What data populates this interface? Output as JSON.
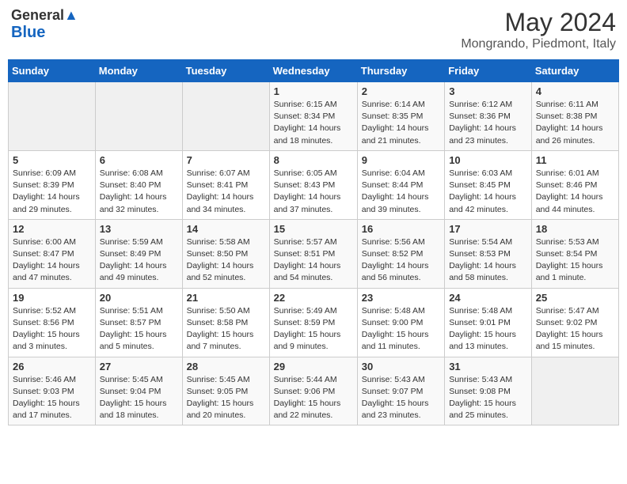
{
  "header": {
    "logo_general": "General",
    "logo_blue": "Blue",
    "month_title": "May 2024",
    "location": "Mongrando, Piedmont, Italy"
  },
  "days_of_week": [
    "Sunday",
    "Monday",
    "Tuesday",
    "Wednesday",
    "Thursday",
    "Friday",
    "Saturday"
  ],
  "weeks": [
    [
      {
        "day": "",
        "info": ""
      },
      {
        "day": "",
        "info": ""
      },
      {
        "day": "",
        "info": ""
      },
      {
        "day": "1",
        "info": "Sunrise: 6:15 AM\nSunset: 8:34 PM\nDaylight: 14 hours and 18 minutes."
      },
      {
        "day": "2",
        "info": "Sunrise: 6:14 AM\nSunset: 8:35 PM\nDaylight: 14 hours and 21 minutes."
      },
      {
        "day": "3",
        "info": "Sunrise: 6:12 AM\nSunset: 8:36 PM\nDaylight: 14 hours and 23 minutes."
      },
      {
        "day": "4",
        "info": "Sunrise: 6:11 AM\nSunset: 8:38 PM\nDaylight: 14 hours and 26 minutes."
      }
    ],
    [
      {
        "day": "5",
        "info": "Sunrise: 6:09 AM\nSunset: 8:39 PM\nDaylight: 14 hours and 29 minutes."
      },
      {
        "day": "6",
        "info": "Sunrise: 6:08 AM\nSunset: 8:40 PM\nDaylight: 14 hours and 32 minutes."
      },
      {
        "day": "7",
        "info": "Sunrise: 6:07 AM\nSunset: 8:41 PM\nDaylight: 14 hours and 34 minutes."
      },
      {
        "day": "8",
        "info": "Sunrise: 6:05 AM\nSunset: 8:43 PM\nDaylight: 14 hours and 37 minutes."
      },
      {
        "day": "9",
        "info": "Sunrise: 6:04 AM\nSunset: 8:44 PM\nDaylight: 14 hours and 39 minutes."
      },
      {
        "day": "10",
        "info": "Sunrise: 6:03 AM\nSunset: 8:45 PM\nDaylight: 14 hours and 42 minutes."
      },
      {
        "day": "11",
        "info": "Sunrise: 6:01 AM\nSunset: 8:46 PM\nDaylight: 14 hours and 44 minutes."
      }
    ],
    [
      {
        "day": "12",
        "info": "Sunrise: 6:00 AM\nSunset: 8:47 PM\nDaylight: 14 hours and 47 minutes."
      },
      {
        "day": "13",
        "info": "Sunrise: 5:59 AM\nSunset: 8:49 PM\nDaylight: 14 hours and 49 minutes."
      },
      {
        "day": "14",
        "info": "Sunrise: 5:58 AM\nSunset: 8:50 PM\nDaylight: 14 hours and 52 minutes."
      },
      {
        "day": "15",
        "info": "Sunrise: 5:57 AM\nSunset: 8:51 PM\nDaylight: 14 hours and 54 minutes."
      },
      {
        "day": "16",
        "info": "Sunrise: 5:56 AM\nSunset: 8:52 PM\nDaylight: 14 hours and 56 minutes."
      },
      {
        "day": "17",
        "info": "Sunrise: 5:54 AM\nSunset: 8:53 PM\nDaylight: 14 hours and 58 minutes."
      },
      {
        "day": "18",
        "info": "Sunrise: 5:53 AM\nSunset: 8:54 PM\nDaylight: 15 hours and 1 minute."
      }
    ],
    [
      {
        "day": "19",
        "info": "Sunrise: 5:52 AM\nSunset: 8:56 PM\nDaylight: 15 hours and 3 minutes."
      },
      {
        "day": "20",
        "info": "Sunrise: 5:51 AM\nSunset: 8:57 PM\nDaylight: 15 hours and 5 minutes."
      },
      {
        "day": "21",
        "info": "Sunrise: 5:50 AM\nSunset: 8:58 PM\nDaylight: 15 hours and 7 minutes."
      },
      {
        "day": "22",
        "info": "Sunrise: 5:49 AM\nSunset: 8:59 PM\nDaylight: 15 hours and 9 minutes."
      },
      {
        "day": "23",
        "info": "Sunrise: 5:48 AM\nSunset: 9:00 PM\nDaylight: 15 hours and 11 minutes."
      },
      {
        "day": "24",
        "info": "Sunrise: 5:48 AM\nSunset: 9:01 PM\nDaylight: 15 hours and 13 minutes."
      },
      {
        "day": "25",
        "info": "Sunrise: 5:47 AM\nSunset: 9:02 PM\nDaylight: 15 hours and 15 minutes."
      }
    ],
    [
      {
        "day": "26",
        "info": "Sunrise: 5:46 AM\nSunset: 9:03 PM\nDaylight: 15 hours and 17 minutes."
      },
      {
        "day": "27",
        "info": "Sunrise: 5:45 AM\nSunset: 9:04 PM\nDaylight: 15 hours and 18 minutes."
      },
      {
        "day": "28",
        "info": "Sunrise: 5:45 AM\nSunset: 9:05 PM\nDaylight: 15 hours and 20 minutes."
      },
      {
        "day": "29",
        "info": "Sunrise: 5:44 AM\nSunset: 9:06 PM\nDaylight: 15 hours and 22 minutes."
      },
      {
        "day": "30",
        "info": "Sunrise: 5:43 AM\nSunset: 9:07 PM\nDaylight: 15 hours and 23 minutes."
      },
      {
        "day": "31",
        "info": "Sunrise: 5:43 AM\nSunset: 9:08 PM\nDaylight: 15 hours and 25 minutes."
      },
      {
        "day": "",
        "info": ""
      }
    ]
  ]
}
